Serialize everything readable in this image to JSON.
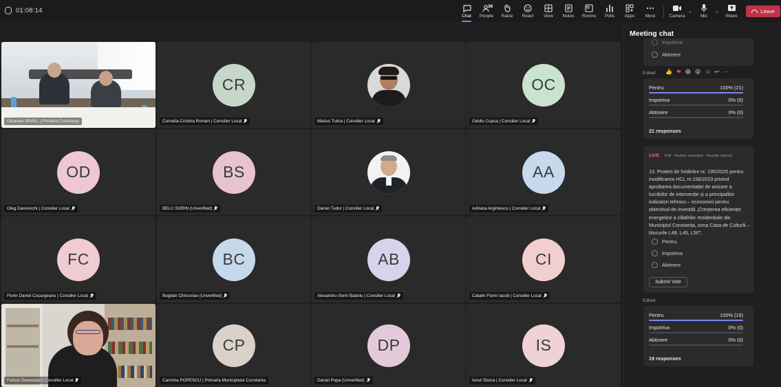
{
  "header": {
    "timer": "01:08:14",
    "tools": [
      {
        "label": "Chat",
        "icon": "chat-icon"
      },
      {
        "label": "People",
        "icon": "people-icon",
        "badge": "36"
      },
      {
        "label": "Raise",
        "icon": "raise-hand-icon"
      },
      {
        "label": "React",
        "icon": "react-icon"
      },
      {
        "label": "View",
        "icon": "view-icon"
      },
      {
        "label": "Notes",
        "icon": "notes-icon"
      },
      {
        "label": "Rooms",
        "icon": "rooms-icon"
      },
      {
        "label": "Polls",
        "icon": "polls-icon"
      },
      {
        "label": "Apps",
        "icon": "apps-icon"
      },
      {
        "label": "More",
        "icon": "more-icon"
      }
    ],
    "camera_label": "Camera",
    "mic_label": "Mic",
    "share_label": "Share",
    "leave_label": "Leave",
    "colors": {
      "accent": "#7f85f5",
      "leave": "#c4314b"
    }
  },
  "participants": [
    {
      "name": "Octavian PAVEL | Primăria Constanța",
      "type": "video"
    },
    {
      "name": "Cornelia-Cristina Roman | Consilier Local",
      "initials": "CR",
      "color": "#c6d6c8"
    },
    {
      "name": "Marius Tulica | Consilier Local",
      "type": "photo"
    },
    {
      "name": "Ovidiu Cupsa | Consilier Local",
      "initials": "OC",
      "color": "#c9e3d0"
    },
    {
      "name": "Oleg Danovschi | Consilier Local",
      "initials": "OD",
      "color": "#eec7d2"
    },
    {
      "name": "BELU SORIN (Unverified)",
      "initials": "BS",
      "color": "#e6c3cf"
    },
    {
      "name": "Daniel Tudor | Consilier Local",
      "type": "photo"
    },
    {
      "name": "Adriana Argintescu | Consilier Local",
      "initials": "AA",
      "color": "#c7d9ec"
    },
    {
      "name": "Florin Daniel Cocargeanu | Consilier Local",
      "initials": "FC",
      "color": "#f0cbd1"
    },
    {
      "name": "Bogdan Chircoriae (Unverified)",
      "initials": "BC",
      "color": "#c6d9ea"
    },
    {
      "name": "Alexandru-Sorin Badoiu | Consilier Local",
      "initials": "AB",
      "color": "#d9d2eb"
    },
    {
      "name": "Catalin Florin Iacob | Consilier Local",
      "initials": "CI",
      "color": "#f1cfd0"
    },
    {
      "name": "Felicia Ovanesian | Consilier Local",
      "type": "video"
    },
    {
      "name": "Carmina POPESCU | Primaria Municipiului Constanta",
      "initials": "CP",
      "color": "#dad1c8"
    },
    {
      "name": "Daniel Popa (Unverified)",
      "initials": "DP",
      "color": "#e2cadb"
    },
    {
      "name": "Ionut Stoica | Consilier Local",
      "initials": "IS",
      "color": "#efd2d6"
    }
  ],
  "chat": {
    "title": "Meeting chat",
    "top_poll": {
      "partial_option": "Impotriva",
      "option": "Abtinere"
    },
    "edited_label": "Edited",
    "result1": {
      "rows": [
        {
          "label": "Pentru",
          "value": "100% (21)",
          "pct": 1.0
        },
        {
          "label": "Impotriva",
          "value": "0% (0)",
          "pct": 0
        },
        {
          "label": "Abtinere",
          "value": "0% (0)",
          "pct": 0
        }
      ],
      "responses": "21 responses"
    },
    "live_poll": {
      "live_label": "LIVE",
      "status": "Poll · Names recorded · Results shared",
      "question": "13.     Proiect de hotărâre nr. 195/2025 pentru modificarea HCL nr.156/2023 privind aprobarea documentației de avizare a lucrărilor de intervenție și a principalilor indicatori tehnico – economici pentru obiectivul de investiții „Creșterea eficienței energetice a clădirilor rezidențiale din Municipiul Constanța, zona Casa de Cultură – blocurile L48, L45, L50”;",
      "options": [
        "Pentru",
        "Impotriva",
        "Abtinere"
      ],
      "submit_label": "Submit Vote"
    },
    "edited_label_2": "Edited",
    "result2": {
      "rows": [
        {
          "label": "Pentru",
          "value": "100% (19)",
          "pct": 1.0
        },
        {
          "label": "Impotriva",
          "value": "0% (0)",
          "pct": 0
        },
        {
          "label": "Abtinere",
          "value": "0% (0)",
          "pct": 0
        }
      ],
      "responses": "19 responses"
    }
  }
}
